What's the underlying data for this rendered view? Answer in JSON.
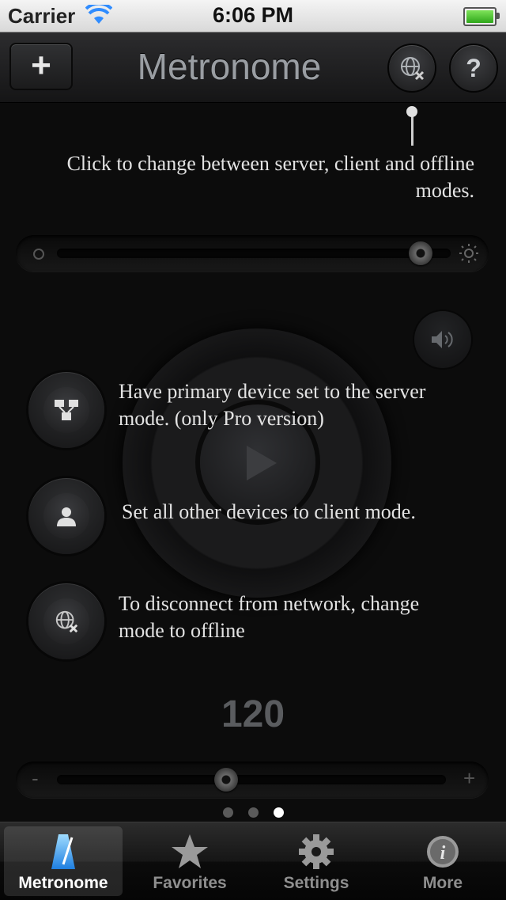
{
  "status_bar": {
    "carrier": "Carrier",
    "time": "6:06 PM"
  },
  "nav": {
    "title": "Metronome",
    "add_label": "+",
    "help_label": "?"
  },
  "hints": {
    "mode_switch": "Click to change between server, client and offline modes.",
    "server": "Have primary device set to the server mode. (only Pro version)",
    "client": "Set all other devices to client mode.",
    "offline": "To disconnect from network, change mode to offline"
  },
  "volume_slider": {
    "level": 0.95
  },
  "tempo": {
    "bpm": "120",
    "minus": "-",
    "plus": "+",
    "position": 0.43
  },
  "pager": {
    "pages": 3,
    "active": 2
  },
  "tabs": [
    {
      "label": "Metronome",
      "icon": "metronome-icon",
      "active": true
    },
    {
      "label": "Favorites",
      "icon": "star-icon",
      "active": false
    },
    {
      "label": "Settings",
      "icon": "gear-icon",
      "active": false
    },
    {
      "label": "More",
      "icon": "info-icon",
      "active": false
    }
  ],
  "colors": {
    "background": "#0c0c0c",
    "accent": "#3aa0ff"
  }
}
